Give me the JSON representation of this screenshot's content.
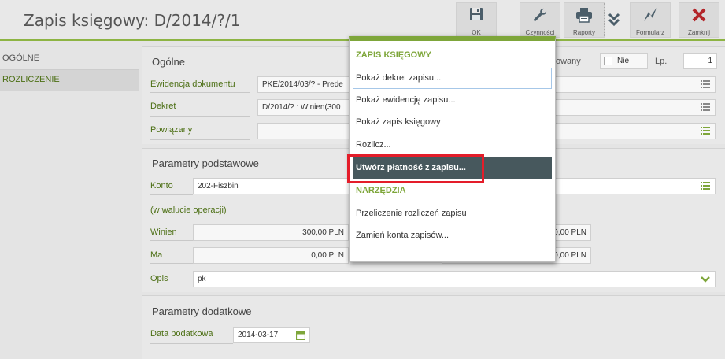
{
  "header": {
    "title": "Zapis księgowy: D/2014/?/1",
    "toolbar": {
      "ok": "OK",
      "czynnosci": "Czynności",
      "raporty": "Raporty",
      "formularz": "Formularz",
      "zamknij": "Zamknij"
    }
  },
  "sidebar": {
    "items": [
      "OGÓLNE",
      "ROZLICZENIE"
    ]
  },
  "ogolne": {
    "title": "Ogólne",
    "zaksiegowany_label": "owany",
    "nie_label": "Nie",
    "lp_label": "Lp.",
    "lp_value": "1",
    "ewidencja_label": "Ewidencja dokumentu",
    "ewidencja_value": "PKE/2014/03/? - Prede",
    "dekret_label": "Dekret",
    "dekret_value": "D/2014/? : Winien(300",
    "powiazany_label": "Powiązany",
    "powiazany_value": ""
  },
  "parametry": {
    "title": "Parametry podstawowe",
    "konto_label": "Konto",
    "konto_value": "202-Fiszbin",
    "waluta_label": "(w walucie operacji)",
    "winien_label": "Winien",
    "winien_value": "300,00 PLN",
    "winien_value2": "0,00 PLN",
    "ma_label": "Ma",
    "ma_value": "0,00 PLN",
    "ma_value2": "0,00 PLN",
    "opis_label": "Opis",
    "opis_value": "pk"
  },
  "dodatkowe": {
    "title": "Parametry dodatkowe",
    "data_label": "Data podatkowa",
    "data_value": "2014-03-17"
  },
  "menu": {
    "section1": "ZAPIS KSIĘGOWY",
    "items1": [
      "Pokaż dekret zapisu...",
      "Pokaż ewidencję zapisu...",
      "Pokaż zapis księgowy",
      "Rozlicz...",
      "Utwórz płatność z zapisu..."
    ],
    "section2": "NARZĘDZIA",
    "items2": [
      "Przeliczenie rozliczeń zapisu",
      "Zamień konta zapisów..."
    ]
  },
  "colors": {
    "accent_green": "#7ea63a",
    "label_green": "#4c6f14",
    "highlight": "#47585d",
    "close_red": "#b3262a",
    "callout_red": "#e41d2a"
  }
}
